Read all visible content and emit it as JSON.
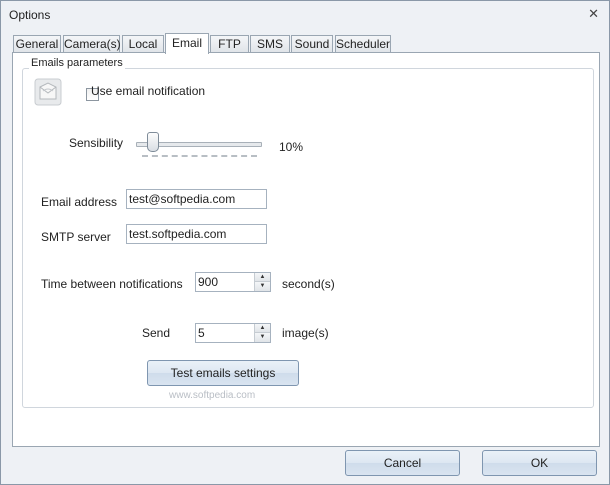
{
  "window": {
    "title": "Options",
    "close_glyph": "✕"
  },
  "tabs": [
    {
      "label": "General"
    },
    {
      "label": "Camera(s)"
    },
    {
      "label": "Local"
    },
    {
      "label": "Email",
      "active": true
    },
    {
      "label": "FTP"
    },
    {
      "label": "SMS"
    },
    {
      "label": "Sound"
    },
    {
      "label": "Scheduler"
    }
  ],
  "email": {
    "group_title": "Emails parameters",
    "icon": "envelope-icon",
    "use_notification_label": "Use email notification",
    "use_notification_checked": false,
    "sensibility_label": "Sensibility",
    "sensibility_value_text": "10%",
    "sensibility_value": 10,
    "address_label": "Email address",
    "address_value": "test@softpedia.com",
    "smtp_label": "SMTP server",
    "smtp_value": "test.softpedia.com",
    "time_label": "Time between notifications",
    "time_value": "900",
    "time_unit": "second(s)",
    "send_label": "Send",
    "send_value": "5",
    "send_unit": "image(s)",
    "test_button": "Test emails settings",
    "watermark": "www.softpedia.com"
  },
  "footer": {
    "cancel": "Cancel",
    "ok": "OK"
  }
}
